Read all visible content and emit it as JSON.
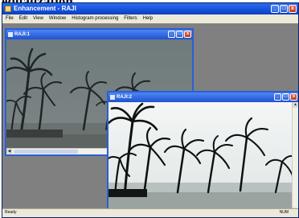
{
  "heading": "equalization",
  "app": {
    "title": "Enhancement - RAJI",
    "controls": {
      "minimize": "_",
      "maximize": "□",
      "close": "x"
    }
  },
  "menu": [
    "File",
    "Edit",
    "View",
    "Window",
    "Histogram processing",
    "Filters",
    "Help"
  ],
  "windows": [
    {
      "title": "RAJI:1",
      "image": "dim low-contrast palm trees on beach"
    },
    {
      "title": "RAJI:2",
      "image": "equalized high-contrast palm trees on beach"
    }
  ],
  "status": {
    "left": "Ready",
    "right": "NUM"
  },
  "colors": {
    "titlebar": "#0a3fc4",
    "mdi_background": "#808080",
    "close_button": "#c23a1c"
  }
}
